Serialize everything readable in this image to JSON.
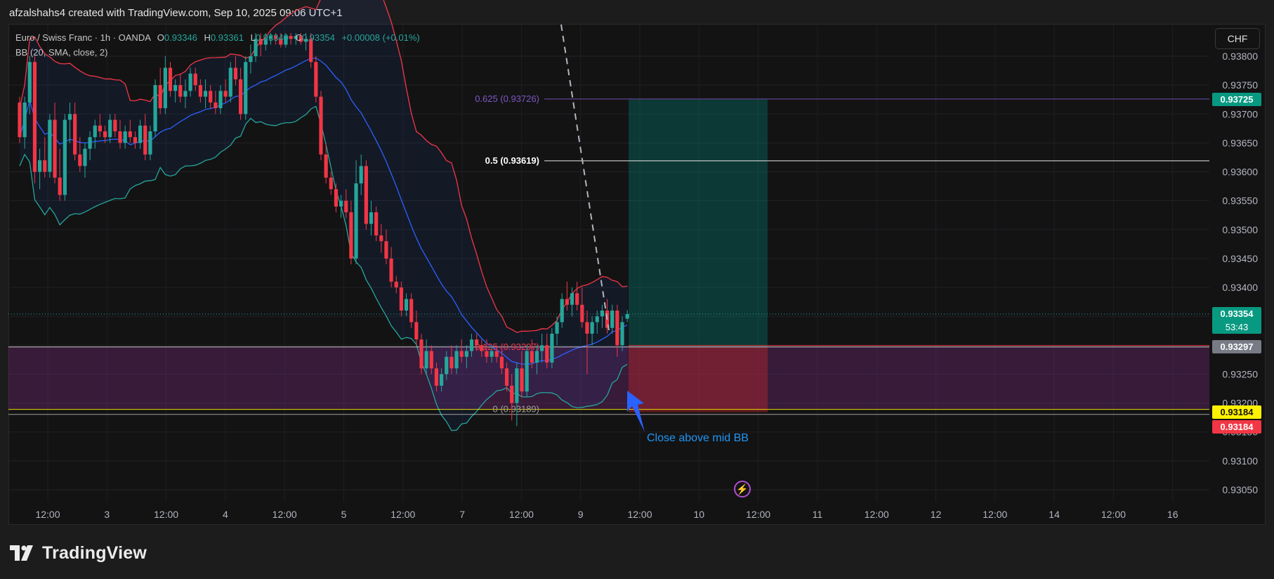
{
  "snapshot_text": "afzalshahs4 created with TradingView.com, Sep 10, 2025 09:06 UTC+1",
  "legend": {
    "symbol": "Euro / Swiss Franc · 1h · OANDA",
    "open_label": "O",
    "open": "0.93346",
    "high_label": "H",
    "high": "0.93361",
    "low_label": "L",
    "low": "0.93340",
    "close_label": "C",
    "close": "0.93354",
    "change": "+0.00008 (+0.01%)",
    "indicator": "BB (20, SMA, close, 2)"
  },
  "currency_button": "CHF",
  "brand": "TradingView",
  "colors": {
    "up": "#26a69a",
    "down": "#f23645",
    "bb_upper": "#f23645",
    "bb_lower": "#26a69a",
    "bb_basis": "#2962ff",
    "fib_0625": "#7e57c2",
    "fib_05": "#ffffff",
    "fib_0125": "#f23645",
    "fib_0": "#9e9e9e",
    "zone": "#7b2a7f",
    "profit": "#00897b",
    "stop": "#c62828",
    "current_price_bg": "#089981",
    "fib_0125_bg": "#787b86",
    "yellow_tag": "#fff200",
    "red_tag": "#f23645"
  },
  "price_tags": {
    "fib_0625": "0.93725",
    "current": "0.93354",
    "countdown": "53:43",
    "fib_0125": "0.93297",
    "fib_0_yellow": "0.93184",
    "fib_0_red": "0.93184"
  },
  "annotation": "Close above mid BB",
  "chart_data": {
    "type": "candlestick",
    "ylim": [
      0.9302,
      0.9384
    ],
    "y_ticks": [
      "0.93050",
      "0.93100",
      "0.93150",
      "0.93200",
      "0.93250",
      "0.93300",
      "0.93350",
      "0.93400",
      "0.93450",
      "0.93500",
      "0.93550",
      "0.93600",
      "0.93650",
      "0.93700",
      "0.93750",
      "0.93800"
    ],
    "x_ticks": [
      "12:00",
      "3",
      "12:00",
      "4",
      "12:00",
      "5",
      "12:00",
      "7",
      "12:00",
      "9",
      "12:00",
      "10",
      "12:00",
      "11",
      "12:00",
      "12",
      "12:00",
      "14",
      "12:00",
      "16"
    ],
    "fib_levels": [
      {
        "label": "0.625 (0.93726)",
        "price": 0.93726
      },
      {
        "label": "0.5 (0.93619)",
        "price": 0.93619
      },
      {
        "label": "0.125 (0.93297)",
        "price": 0.93297
      },
      {
        "label": "0 (0.93189)",
        "price": 0.93189
      }
    ],
    "long_position": {
      "entry": 0.93297,
      "target": 0.93725,
      "stop": 0.93184
    },
    "candles": [
      [
        0.9372,
        0.9373,
        0.9365,
        0.9366
      ],
      [
        0.9366,
        0.9373,
        0.9364,
        0.9372
      ],
      [
        0.9372,
        0.938,
        0.937,
        0.9379
      ],
      [
        0.9379,
        0.938,
        0.9358,
        0.936
      ],
      [
        0.936,
        0.9364,
        0.9357,
        0.9362
      ],
      [
        0.9362,
        0.9366,
        0.9359,
        0.936
      ],
      [
        0.936,
        0.937,
        0.9359,
        0.9369
      ],
      [
        0.9369,
        0.9372,
        0.9358,
        0.9359
      ],
      [
        0.9359,
        0.9364,
        0.9355,
        0.9356
      ],
      [
        0.9356,
        0.937,
        0.9355,
        0.9369
      ],
      [
        0.9369,
        0.9372,
        0.9365,
        0.937
      ],
      [
        0.937,
        0.9372,
        0.9362,
        0.9363
      ],
      [
        0.9363,
        0.9366,
        0.936,
        0.9361
      ],
      [
        0.9361,
        0.9365,
        0.9359,
        0.9364
      ],
      [
        0.9364,
        0.9367,
        0.9362,
        0.9366
      ],
      [
        0.9366,
        0.9369,
        0.9364,
        0.9368
      ],
      [
        0.9368,
        0.937,
        0.9366,
        0.9367
      ],
      [
        0.9367,
        0.9368,
        0.9365,
        0.9366
      ],
      [
        0.9366,
        0.937,
        0.9365,
        0.9369
      ],
      [
        0.9369,
        0.937,
        0.9366,
        0.9367
      ],
      [
        0.9367,
        0.9369,
        0.9364,
        0.9365
      ],
      [
        0.9365,
        0.9368,
        0.9364,
        0.9367
      ],
      [
        0.9367,
        0.9369,
        0.9365,
        0.9366
      ],
      [
        0.9366,
        0.9367,
        0.9364,
        0.9365
      ],
      [
        0.9365,
        0.9369,
        0.9364,
        0.9368
      ],
      [
        0.9368,
        0.937,
        0.9362,
        0.9363
      ],
      [
        0.9363,
        0.9368,
        0.9362,
        0.9367
      ],
      [
        0.9367,
        0.9376,
        0.9366,
        0.9375
      ],
      [
        0.9375,
        0.9378,
        0.937,
        0.9371
      ],
      [
        0.9371,
        0.938,
        0.937,
        0.9378
      ],
      [
        0.9378,
        0.9379,
        0.9373,
        0.9374
      ],
      [
        0.9374,
        0.9376,
        0.9372,
        0.9375
      ],
      [
        0.9375,
        0.9377,
        0.9372,
        0.9373
      ],
      [
        0.9373,
        0.9376,
        0.9371,
        0.9374
      ],
      [
        0.9374,
        0.9378,
        0.9373,
        0.9377
      ],
      [
        0.9377,
        0.9378,
        0.9374,
        0.9375
      ],
      [
        0.9375,
        0.9376,
        0.9372,
        0.9373
      ],
      [
        0.9373,
        0.9376,
        0.9371,
        0.9374
      ],
      [
        0.9374,
        0.9375,
        0.9371,
        0.9372
      ],
      [
        0.9372,
        0.9374,
        0.937,
        0.9371
      ],
      [
        0.9371,
        0.9375,
        0.937,
        0.9374
      ],
      [
        0.9374,
        0.9376,
        0.9372,
        0.9373
      ],
      [
        0.9373,
        0.9379,
        0.9372,
        0.9378
      ],
      [
        0.9378,
        0.938,
        0.9375,
        0.9376
      ],
      [
        0.9376,
        0.9378,
        0.9369,
        0.937
      ],
      [
        0.937,
        0.938,
        0.9369,
        0.9379
      ],
      [
        0.9379,
        0.9382,
        0.9377,
        0.938
      ],
      [
        0.938,
        0.9384,
        0.9379,
        0.9383
      ],
      [
        0.9383,
        0.9384,
        0.938,
        0.9382
      ],
      [
        0.9382,
        0.9384,
        0.9381,
        0.9383
      ],
      [
        0.9383,
        0.9384,
        0.9382,
        0.93835
      ],
      [
        0.93835,
        0.9384,
        0.9382,
        0.9383
      ],
      [
        0.9383,
        0.9384,
        0.93815,
        0.9382
      ],
      [
        0.9382,
        0.9384,
        0.93815,
        0.93835
      ],
      [
        0.93835,
        0.9384,
        0.9382,
        0.9383
      ],
      [
        0.9383,
        0.9384,
        0.9382,
        0.93835
      ],
      [
        0.93835,
        0.9384,
        0.9382,
        0.93825
      ],
      [
        0.93825,
        0.9384,
        0.9381,
        0.9383
      ],
      [
        0.9383,
        0.9384,
        0.9378,
        0.9379
      ],
      [
        0.9379,
        0.938,
        0.9372,
        0.9373
      ],
      [
        0.9373,
        0.9374,
        0.9362,
        0.9363
      ],
      [
        0.9363,
        0.9365,
        0.9358,
        0.9359
      ],
      [
        0.9359,
        0.936,
        0.9356,
        0.9357
      ],
      [
        0.9357,
        0.9358,
        0.9353,
        0.9354
      ],
      [
        0.9354,
        0.9356,
        0.9352,
        0.9355
      ],
      [
        0.9355,
        0.9357,
        0.9352,
        0.9353
      ],
      [
        0.9353,
        0.9355,
        0.9344,
        0.9345
      ],
      [
        0.9345,
        0.9362,
        0.9344,
        0.9358
      ],
      [
        0.9358,
        0.9363,
        0.9356,
        0.9361
      ],
      [
        0.9361,
        0.9362,
        0.935,
        0.9351
      ],
      [
        0.9351,
        0.9355,
        0.9349,
        0.9353
      ],
      [
        0.9353,
        0.9354,
        0.9348,
        0.9349
      ],
      [
        0.9349,
        0.9351,
        0.9346,
        0.9348
      ],
      [
        0.9348,
        0.935,
        0.9344,
        0.9345
      ],
      [
        0.9345,
        0.9347,
        0.934,
        0.9341
      ],
      [
        0.9341,
        0.9342,
        0.9339,
        0.934
      ],
      [
        0.934,
        0.9341,
        0.9335,
        0.9336
      ],
      [
        0.9336,
        0.9339,
        0.9335,
        0.9338
      ],
      [
        0.9338,
        0.9339,
        0.9333,
        0.9334
      ],
      [
        0.9334,
        0.9336,
        0.933,
        0.9331
      ],
      [
        0.9331,
        0.9332,
        0.9325,
        0.9326
      ],
      [
        0.9326,
        0.9331,
        0.9325,
        0.9329
      ],
      [
        0.9329,
        0.933,
        0.9325,
        0.9326
      ],
      [
        0.9326,
        0.9327,
        0.9322,
        0.9323
      ],
      [
        0.9323,
        0.9326,
        0.9322,
        0.9325
      ],
      [
        0.9325,
        0.9329,
        0.9324,
        0.9328
      ],
      [
        0.9328,
        0.933,
        0.9325,
        0.9326
      ],
      [
        0.9326,
        0.933,
        0.9325,
        0.9329
      ],
      [
        0.9329,
        0.9331,
        0.9327,
        0.9328
      ],
      [
        0.9328,
        0.933,
        0.9326,
        0.9329
      ],
      [
        0.9329,
        0.9332,
        0.9328,
        0.9331
      ],
      [
        0.9331,
        0.9332,
        0.9329,
        0.933
      ],
      [
        0.933,
        0.9331,
        0.9328,
        0.9329
      ],
      [
        0.9329,
        0.9331,
        0.9327,
        0.9328
      ],
      [
        0.9328,
        0.933,
        0.9327,
        0.9329
      ],
      [
        0.9329,
        0.933,
        0.9327,
        0.9328
      ],
      [
        0.9328,
        0.9329,
        0.9325,
        0.9326
      ],
      [
        0.9326,
        0.9327,
        0.9322,
        0.9323
      ],
      [
        0.9323,
        0.9325,
        0.9317,
        0.932
      ],
      [
        0.932,
        0.9327,
        0.9316,
        0.9326
      ],
      [
        0.9326,
        0.9329,
        0.9321,
        0.9322
      ],
      [
        0.9322,
        0.933,
        0.9321,
        0.9329
      ],
      [
        0.9329,
        0.9331,
        0.9326,
        0.9327
      ],
      [
        0.9327,
        0.933,
        0.9325,
        0.9329
      ],
      [
        0.9329,
        0.9332,
        0.9327,
        0.933
      ],
      [
        0.933,
        0.9332,
        0.9326,
        0.9327
      ],
      [
        0.9327,
        0.9333,
        0.9326,
        0.9332
      ],
      [
        0.9332,
        0.9335,
        0.933,
        0.9334
      ],
      [
        0.9334,
        0.9339,
        0.9333,
        0.9338
      ],
      [
        0.9338,
        0.9341,
        0.9336,
        0.9337
      ],
      [
        0.9337,
        0.934,
        0.9335,
        0.9339
      ],
      [
        0.9339,
        0.9341,
        0.9336,
        0.9337
      ],
      [
        0.9337,
        0.934,
        0.9333,
        0.9334
      ],
      [
        0.9334,
        0.9336,
        0.9325,
        0.9332
      ],
      [
        0.9332,
        0.9335,
        0.933,
        0.9334
      ],
      [
        0.9334,
        0.9336,
        0.9332,
        0.9335
      ],
      [
        0.9335,
        0.9337,
        0.9333,
        0.9336
      ],
      [
        0.9336,
        0.9338,
        0.9332,
        0.9333
      ],
      [
        0.9333,
        0.9337,
        0.9332,
        0.9336
      ],
      [
        0.9336,
        0.9337,
        0.9328,
        0.933
      ],
      [
        0.933,
        0.9335,
        0.9329,
        0.9334
      ],
      [
        0.93346,
        0.93361,
        0.9334,
        0.93354
      ]
    ]
  }
}
